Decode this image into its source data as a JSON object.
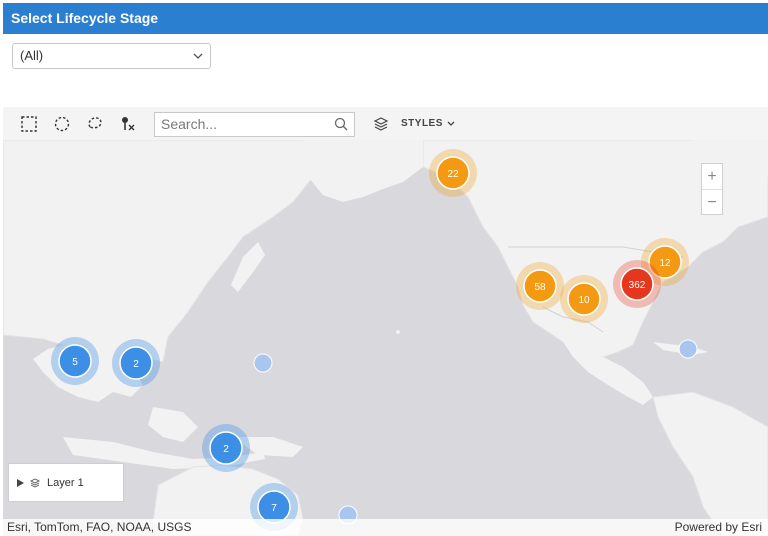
{
  "header": {
    "title": "Select Lifecycle Stage"
  },
  "filter": {
    "selected": "(All)"
  },
  "toolbar": {
    "search_placeholder": "Search...",
    "styles_label": "STYLES"
  },
  "zoom": {
    "in_label": "+",
    "out_label": "−"
  },
  "layer_list": {
    "items": [
      {
        "label": "Layer 1"
      }
    ]
  },
  "attribution": {
    "left": "Esri, TomTom, FAO, NOAA, USGS",
    "right": "Powered by Esri"
  },
  "colors": {
    "header": "#2b7fd0",
    "blue_cluster": "#3d8fe6",
    "orange_cluster": "#f39a12",
    "red_cluster": "#e5371d",
    "water": "#d9d8dd",
    "land": "#f2f2f2"
  },
  "clusters": [
    {
      "count": "22",
      "color": "orange"
    },
    {
      "count": "12",
      "color": "orange"
    },
    {
      "count": "58",
      "color": "orange"
    },
    {
      "count": "10",
      "color": "orange"
    },
    {
      "count": "362",
      "color": "red"
    },
    {
      "count": "5",
      "color": "blue"
    },
    {
      "count": "2",
      "color": "blue"
    },
    {
      "count": "2",
      "color": "blue"
    },
    {
      "count": "7",
      "color": "blue"
    }
  ]
}
